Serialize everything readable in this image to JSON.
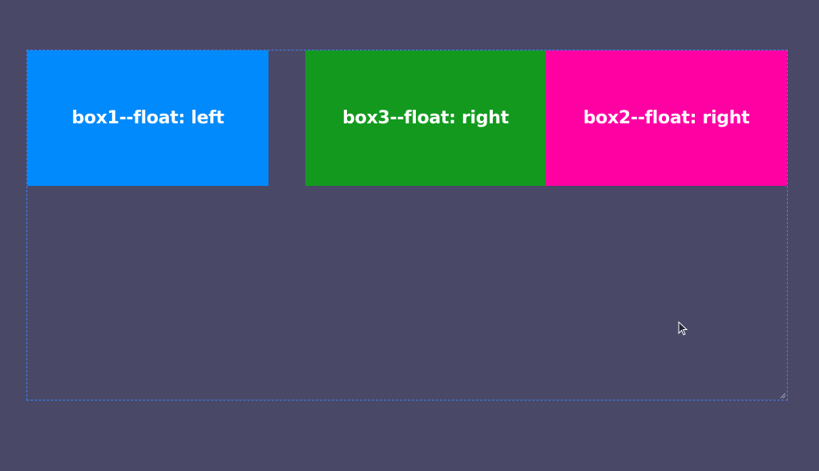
{
  "boxes": {
    "box1": {
      "label": "box1--float: left",
      "color": "#008afc"
    },
    "box2": {
      "label": "box2--float: right",
      "color": "#ff00a3"
    },
    "box3": {
      "label": "box3--float: right",
      "color": "#139a1e"
    }
  },
  "colors": {
    "background": "#494867",
    "container_border": "#3b82f6"
  },
  "icons": {
    "cursor": "mouse-pointer-icon",
    "resize": "resize-handle-icon"
  }
}
